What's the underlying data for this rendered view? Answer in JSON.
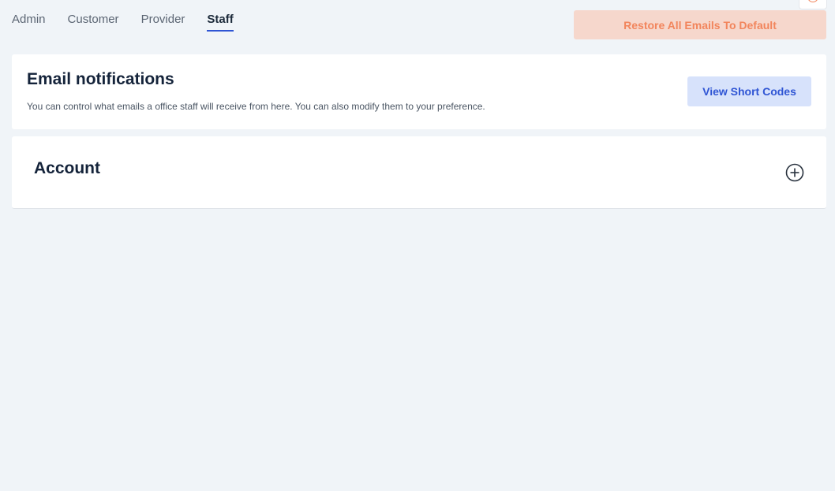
{
  "tabs": [
    {
      "label": "Admin",
      "active": false
    },
    {
      "label": "Customer",
      "active": false
    },
    {
      "label": "Provider",
      "active": false
    },
    {
      "label": "Staff",
      "active": true
    }
  ],
  "actions": {
    "restore_label": "Restore All Emails To Default"
  },
  "email_card": {
    "title": "Email notifications",
    "description": "You can control what emails a office staff will receive from here. You can also modify them to your preference.",
    "shortcodes_label": "View Short Codes"
  },
  "sections": [
    {
      "title": "Account",
      "expand_icon": "plus-circle-icon"
    }
  ],
  "colors": {
    "accent": "#2f55d4",
    "restore_text": "#f2855c",
    "restore_bg": "#f6d7cc",
    "shortcodes_bg": "#d7e2fb",
    "page_bg": "#f0f4f8"
  }
}
